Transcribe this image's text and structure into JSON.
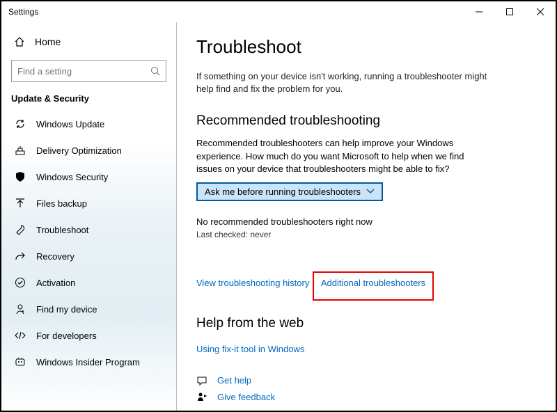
{
  "window": {
    "title": "Settings"
  },
  "sidebar": {
    "home": "Home",
    "search_placeholder": "Find a setting",
    "category": "Update & Security",
    "items": [
      {
        "label": "Windows Update"
      },
      {
        "label": "Delivery Optimization"
      },
      {
        "label": "Windows Security"
      },
      {
        "label": "Files backup"
      },
      {
        "label": "Troubleshoot"
      },
      {
        "label": "Recovery"
      },
      {
        "label": "Activation"
      },
      {
        "label": "Find my device"
      },
      {
        "label": "For developers"
      },
      {
        "label": "Windows Insider Program"
      }
    ]
  },
  "main": {
    "heading": "Troubleshoot",
    "intro": "If something on your device isn't working, running a troubleshooter might help find and fix the problem for you.",
    "recommended_heading": "Recommended troubleshooting",
    "recommended_text": "Recommended troubleshooters can help improve your Windows experience. How much do you want Microsoft to help when we find issues on your device that troubleshooters might be able to fix?",
    "dropdown_value": "Ask me before running troubleshooters",
    "no_recommended": "No recommended troubleshooters right now",
    "last_checked": "Last checked: never",
    "history_link": "View troubleshooting history",
    "additional_link": "Additional troubleshooters",
    "help_heading": "Help from the web",
    "fixit_link": "Using fix-it tool in Windows",
    "get_help": "Get help",
    "give_feedback": "Give feedback"
  }
}
